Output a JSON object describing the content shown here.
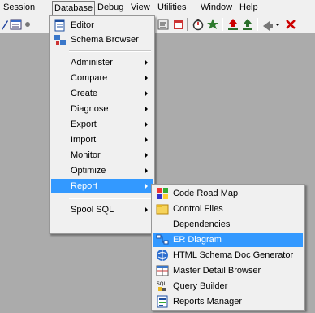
{
  "menubar": {
    "items": [
      {
        "label": "Session"
      },
      {
        "label": "Database"
      },
      {
        "label": "Debug"
      },
      {
        "label": "View"
      },
      {
        "label": "Utilities"
      },
      {
        "label": "Window"
      },
      {
        "label": "Help"
      }
    ]
  },
  "database_menu": {
    "top_items": [
      {
        "label": "Editor",
        "icon": "editor-icon"
      },
      {
        "label": "Schema Browser",
        "icon": "schema-browser-icon"
      }
    ],
    "items": [
      {
        "label": "Administer"
      },
      {
        "label": "Compare"
      },
      {
        "label": "Create"
      },
      {
        "label": "Diagnose"
      },
      {
        "label": "Export"
      },
      {
        "label": "Import"
      },
      {
        "label": "Monitor"
      },
      {
        "label": "Optimize"
      },
      {
        "label": "Report"
      }
    ],
    "bottom_items": [
      {
        "label": "Spool SQL"
      }
    ]
  },
  "report_menu": {
    "items": [
      {
        "label": "Code Road Map",
        "icon": "code-road-map-icon"
      },
      {
        "label": "Control Files",
        "icon": "control-files-icon"
      },
      {
        "label": "Dependencies",
        "icon": ""
      },
      {
        "label": "ER Diagram",
        "icon": "er-diagram-icon"
      },
      {
        "label": "HTML Schema Doc Generator",
        "icon": "html-schema-doc-icon"
      },
      {
        "label": "Master Detail Browser",
        "icon": "master-detail-icon"
      },
      {
        "label": "Query Builder",
        "icon": "query-builder-icon"
      },
      {
        "label": "Reports Manager",
        "icon": "reports-manager-icon"
      }
    ]
  },
  "colors": {
    "highlight": "#3399ff",
    "menu_bg": "#f0f0f0",
    "workspace_bg": "#ababab"
  }
}
